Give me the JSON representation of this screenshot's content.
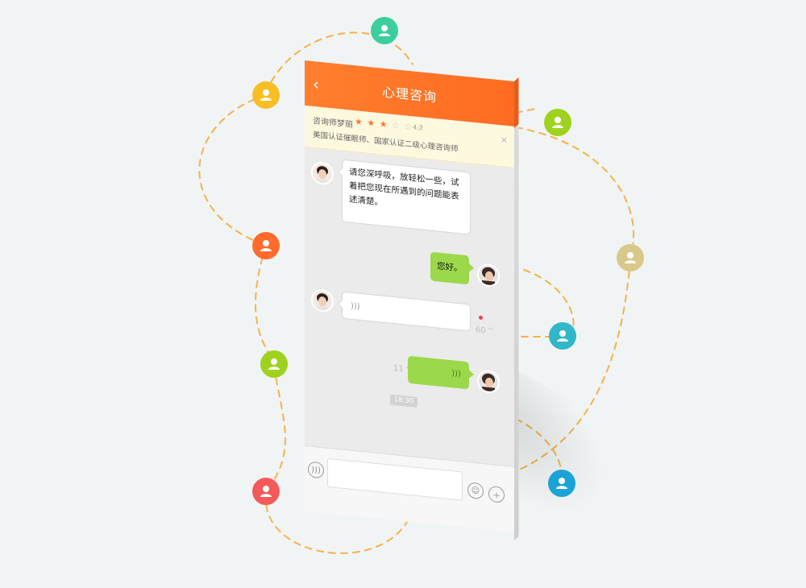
{
  "network": {
    "nodes": [
      {
        "icon": "user-icon",
        "color": "#3ccf9b"
      },
      {
        "icon": "user-icon",
        "color": "#f7bf24"
      },
      {
        "icon": "user-icon",
        "color": "#9ed21f"
      },
      {
        "icon": "user-icon",
        "color": "#ff6b2b"
      },
      {
        "icon": "user-icon",
        "color": "#d8c98a"
      },
      {
        "icon": "user-icon",
        "color": "#30b7c8"
      },
      {
        "icon": "user-icon",
        "color": "#9ed21f"
      },
      {
        "icon": "user-icon",
        "color": "#1ba3d6"
      },
      {
        "icon": "user-icon",
        "color": "#f35a5a"
      },
      {
        "icon": "user-icon",
        "color": "#f7bf24"
      }
    ],
    "line_color": "#f4b24a"
  },
  "header": {
    "back_icon": "chevron-left-icon",
    "title": "心理咨询",
    "color": "#ff7a2b"
  },
  "counselor": {
    "name": "咨询师梦丽",
    "stars_on": "★ ★ ★",
    "stars_off": "☆ ☆ ☆",
    "rating": "4.7",
    "certification": "美国认证催眠师、国家认证二级心理咨询师",
    "close_icon": "close-icon"
  },
  "messages": [
    {
      "side": "left",
      "type": "text",
      "text_lines": [
        "请您深呼吸，放轻松一些，试",
        "着把您现在所遇到的问题能表",
        "述清楚。"
      ]
    },
    {
      "side": "right",
      "type": "text",
      "text": "您好。"
    },
    {
      "side": "left",
      "type": "voice",
      "duration": "60 ''",
      "unread": true
    },
    {
      "side": "right",
      "type": "voice",
      "duration": "11 ''"
    }
  ],
  "timestamp": "18:30",
  "input_bar": {
    "voice_button_icon": "voice-icon",
    "placeholder": "",
    "emoji_button_icon": "emoji-icon",
    "plus_button_icon": "plus-icon"
  }
}
